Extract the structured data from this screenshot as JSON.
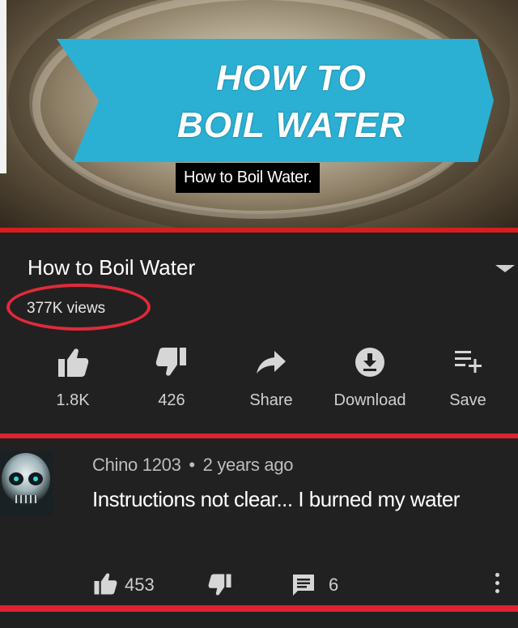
{
  "thumbnail": {
    "banner_line1": "HOW TO",
    "banner_line2": "BOIL WATER",
    "caption": "How to Boil Water.",
    "banner_color": "#2bb0d3"
  },
  "video": {
    "title": "How to Boil Water",
    "views": "377K views",
    "highlight_color": "#e02a3a"
  },
  "actions": [
    {
      "icon": "thumbs-up-icon",
      "label": "1.8K"
    },
    {
      "icon": "thumbs-down-icon",
      "label": "426"
    },
    {
      "icon": "share-icon",
      "label": "Share"
    },
    {
      "icon": "download-icon",
      "label": "Download"
    },
    {
      "icon": "add-to-playlist-icon",
      "label": "Save"
    }
  ],
  "comment": {
    "author": "Chino 1203",
    "separator": "•",
    "time": "2 years ago",
    "text": "Instructions not clear... I burned my water",
    "likes": "453",
    "replies": "6"
  }
}
